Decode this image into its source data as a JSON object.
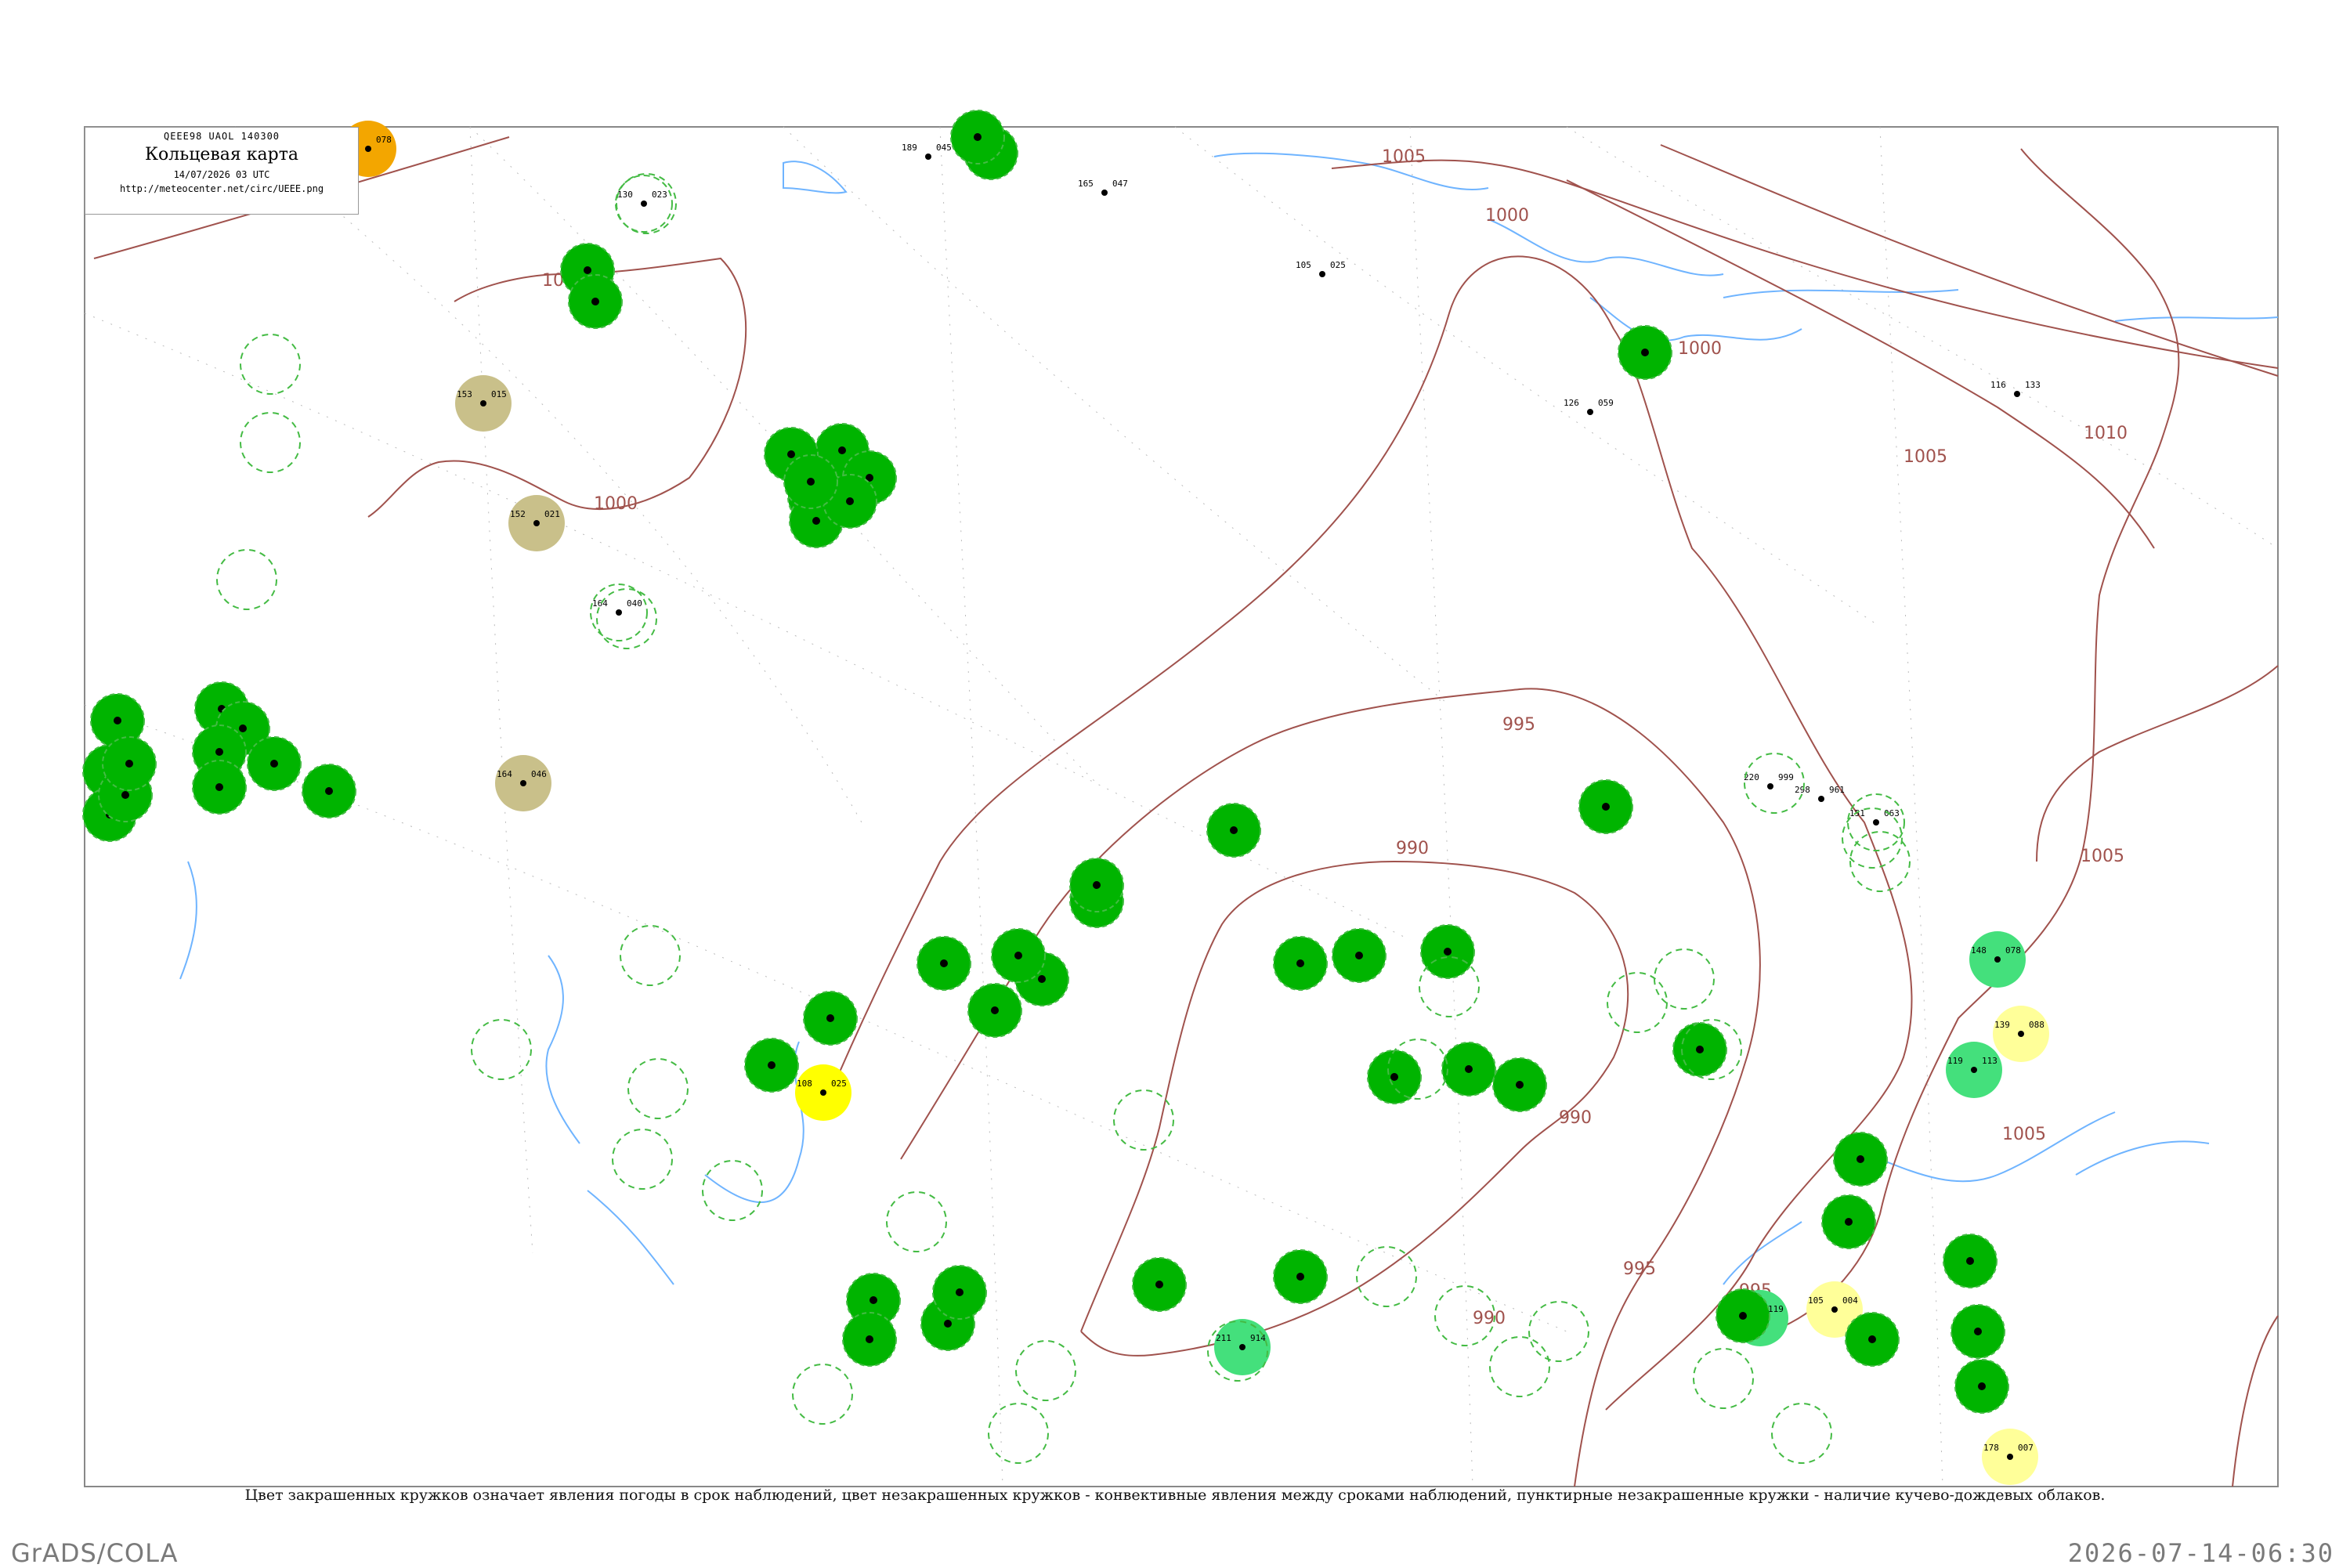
{
  "header": {
    "code": "QEEE98  UAOL  140300",
    "title": "Кольцевая карта",
    "date": "14/07/2026 03 UTC",
    "url": "http://meteocenter.net/circ/UEEE.png"
  },
  "caption": "Цвет закрашенных кружков означает явления погоды в срок наблюдений, цвет незакрашенных кружков - конвективные явления между сроками наблюдений, пунктирные незакрашенные кружки - наличие кучево-дождевых облаков.",
  "footer": {
    "software": "GrADS/COLA",
    "timestamp": "2026-07-14-06:30"
  },
  "colors": {
    "isobar": "#a0524d",
    "water": "#6fb4ff",
    "frame": "#888888",
    "dense_green": "#00b400",
    "light_green": "#44e07c",
    "olive": "#c9c08a",
    "yellow": "#ffff00",
    "pale_yellow": "#ffff99",
    "orange": "#f3a600",
    "dashed_ring": "#44bb44"
  },
  "isobar_labels": [
    "1005",
    "1000",
    "1000",
    "1000",
    "1005",
    "1010",
    "995",
    "990",
    "990",
    "995",
    "1005",
    "1005",
    "995",
    "990",
    "1000"
  ],
  "stations": [
    {
      "label": "078",
      "p": "11",
      "fill": "orange"
    },
    {
      "label": "023",
      "p": "130",
      "fill": "dashed"
    },
    {
      "label": "045",
      "p": "189",
      "fill": "none"
    },
    {
      "label": "047",
      "p": "165",
      "fill": "none"
    },
    {
      "label": "025",
      "p": "105",
      "fill": "none"
    },
    {
      "label": "015",
      "p": "153",
      "fill": "olive"
    },
    {
      "label": "021",
      "p": "152",
      "fill": "olive"
    },
    {
      "label": "046",
      "p": "164",
      "fill": "olive"
    },
    {
      "label": "040",
      "p": "164",
      "fill": "dashed"
    },
    {
      "label": "059",
      "p": "126",
      "fill": "none"
    },
    {
      "label": "133",
      "p": "116",
      "fill": "none"
    },
    {
      "label": "063",
      "p": "151",
      "fill": "dashed"
    },
    {
      "label": "999",
      "p": "220",
      "fill": "none"
    },
    {
      "label": "961",
      "p": "298",
      "fill": "none"
    },
    {
      "label": "088",
      "p": "139",
      "fill": "pale_yellow"
    },
    {
      "label": "004",
      "p": "105",
      "fill": "pale_yellow"
    },
    {
      "label": "007",
      "p": "178",
      "fill": "pale_yellow"
    },
    {
      "label": "025",
      "p": "108",
      "fill": "yellow"
    },
    {
      "label": "078",
      "p": "148",
      "fill": "light_green"
    },
    {
      "label": "113",
      "p": "119",
      "fill": "light_green"
    },
    {
      "label": "914",
      "p": "211",
      "fill": "light_green"
    },
    {
      "label": "119",
      "p": "93",
      "fill": "light_green"
    }
  ]
}
